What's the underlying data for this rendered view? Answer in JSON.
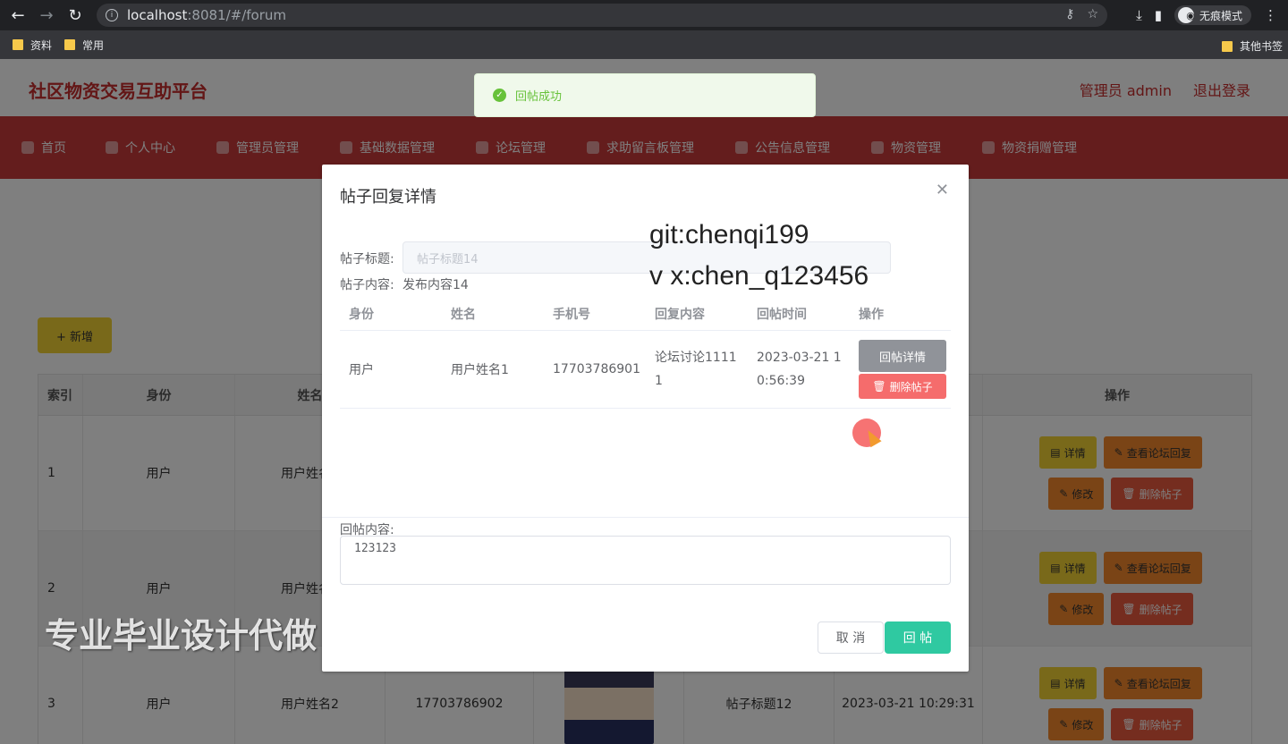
{
  "browser": {
    "url_host": "localhost",
    "url_path": ":8081/#/forum",
    "incognito_label": "无痕模式",
    "bookmarks": [
      "资料",
      "常用"
    ],
    "other_bookmarks": "其他书签"
  },
  "header": {
    "brand": "社区物资交易互助平台",
    "user": "管理员 admin",
    "logout": "退出登录"
  },
  "menu": [
    "首页",
    "个人中心",
    "管理员管理",
    "基础数据管理",
    "论坛管理",
    "求助留言板管理",
    "公告信息管理",
    "物资管理",
    "物资捐赠管理"
  ],
  "toolbar": {
    "add_label": "+ 新增"
  },
  "table": {
    "headers": [
      "索引",
      "身份",
      "姓名",
      "",
      "",
      "",
      "",
      "操作"
    ],
    "rows": [
      {
        "index": "1",
        "role": "用户",
        "name": "用户姓名1",
        "phone": "",
        "title": "",
        "time": ""
      },
      {
        "index": "2",
        "role": "用户",
        "name": "用户姓名1",
        "phone": "",
        "title": "",
        "time": ""
      },
      {
        "index": "3",
        "role": "用户",
        "name": "用户姓名2",
        "phone": "17703786902",
        "title": "帖子标题12",
        "time": "2023-03-21 10:29:31"
      }
    ],
    "ops": {
      "detail": "详情",
      "view_replies": "查看论坛回复",
      "edit": "修改",
      "delete": "删除帖子"
    }
  },
  "toast": {
    "message": "回帖成功"
  },
  "dialog": {
    "title": "帖子回复详情",
    "title_label": "帖子标题:",
    "title_value": "帖子标题14",
    "content_label": "帖子内容:",
    "content_value": "发布内容14",
    "columns": [
      "身份",
      "姓名",
      "手机号",
      "回复内容",
      "回帖时间",
      "操作"
    ],
    "row": {
      "role": "用户",
      "name": "用户姓名1",
      "phone": "17703786901",
      "reply": "论坛讨论11111",
      "time": "2023-03-21 10:56:39"
    },
    "row_ops": {
      "detail": "回帖详情",
      "delete": "删除帖子"
    },
    "reply_label": "回帖内容:",
    "reply_value": "123123",
    "cancel": "取 消",
    "submit": "回 帖"
  },
  "watermarks": {
    "git": "git:chenqi199",
    "vx": "v x:chen_q123456",
    "ad": "专业毕业设计代做"
  }
}
